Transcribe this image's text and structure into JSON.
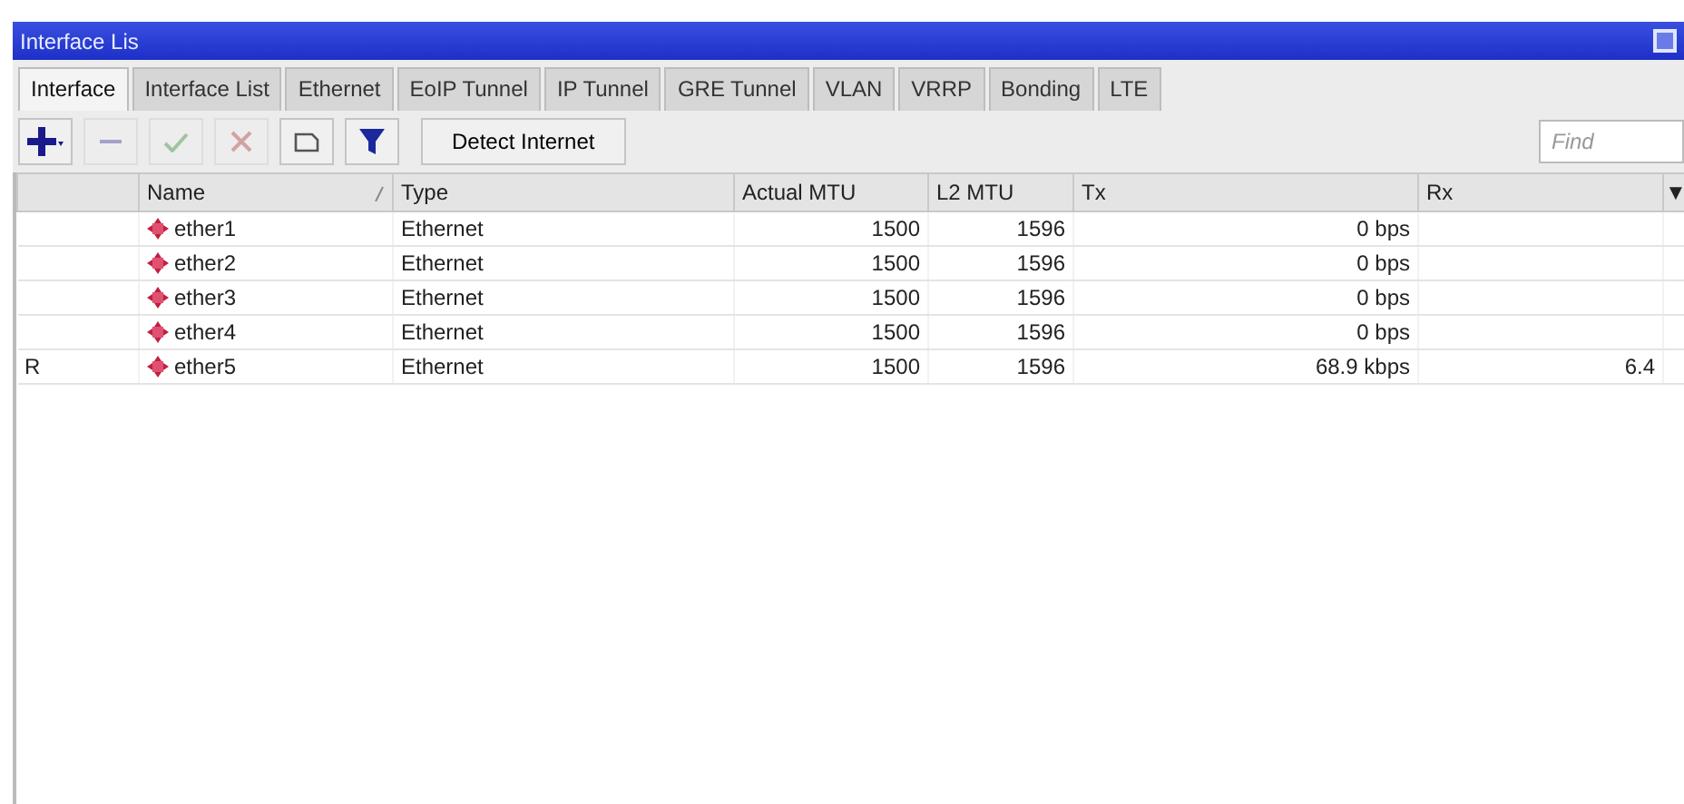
{
  "window": {
    "title": "Interface Lis"
  },
  "tabs": [
    {
      "label": "Interface",
      "selected": true
    },
    {
      "label": "Interface List",
      "selected": false
    },
    {
      "label": "Ethernet",
      "selected": false
    },
    {
      "label": "EoIP Tunnel",
      "selected": false
    },
    {
      "label": "IP Tunnel",
      "selected": false
    },
    {
      "label": "GRE Tunnel",
      "selected": false
    },
    {
      "label": "VLAN",
      "selected": false
    },
    {
      "label": "VRRP",
      "selected": false
    },
    {
      "label": "Bonding",
      "selected": false
    },
    {
      "label": "LTE",
      "selected": false
    }
  ],
  "toolbar": {
    "buttons": [
      {
        "kind": "add",
        "disabled": false
      },
      {
        "kind": "remove",
        "disabled": true
      },
      {
        "kind": "enable",
        "disabled": true
      },
      {
        "kind": "disable",
        "disabled": true
      },
      {
        "kind": "comment",
        "disabled": false
      },
      {
        "kind": "filter",
        "disabled": false
      }
    ],
    "detect_button": "Detect Internet",
    "search": {
      "placeholder": "Find"
    }
  },
  "table": {
    "columns": [
      "Name",
      "Type",
      "Actual MTU",
      "L2 MTU",
      "Tx",
      "Rx",
      "▼"
    ],
    "rows": [
      {
        "flag": "",
        "name": "ether1",
        "type": "Ethernet",
        "actual_mtu": "1500",
        "l2_mtu": "1596",
        "tx": "0 bps"
      },
      {
        "flag": "",
        "name": "ether2",
        "type": "Ethernet",
        "actual_mtu": "1500",
        "l2_mtu": "1596",
        "tx": "0 bps"
      },
      {
        "flag": "",
        "name": "ether3",
        "type": "Ethernet",
        "actual_mtu": "1500",
        "l2_mtu": "1596",
        "tx": "0 bps"
      },
      {
        "flag": "",
        "name": "ether4",
        "type": "Ethernet",
        "actual_mtu": "1500",
        "l2_mtu": "1596",
        "tx": "0 bps"
      },
      {
        "flag": "R",
        "name": "ether5",
        "type": "Ethernet",
        "actual_mtu": "1500",
        "l2_mtu": "1596",
        "tx": "68.9 kbps",
        "rx": "6.4"
      }
    ]
  }
}
